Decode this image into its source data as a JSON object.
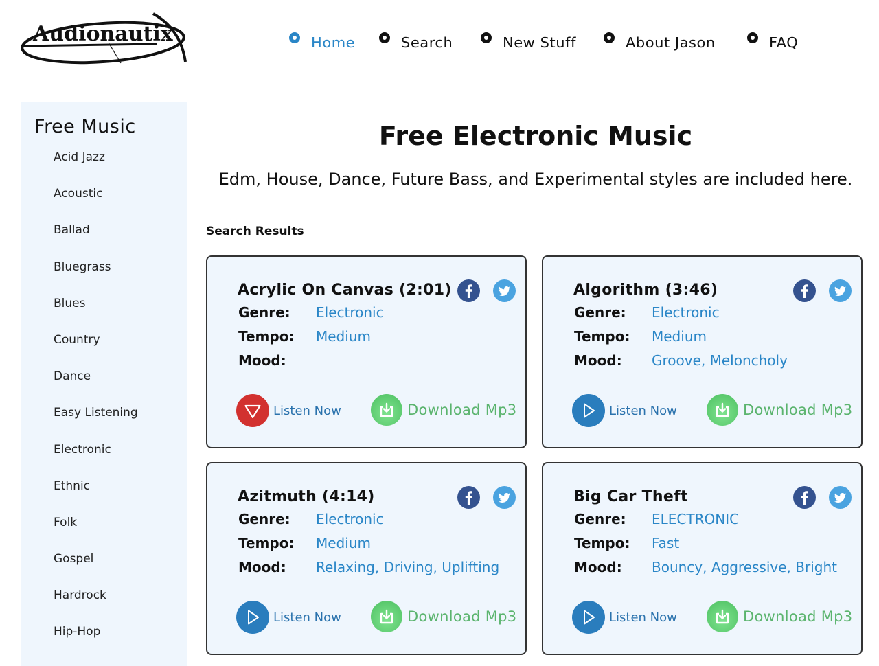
{
  "header": {
    "logo_text": "Audionautix",
    "nav": [
      {
        "label": "Home",
        "active": true
      },
      {
        "label": "Search",
        "active": false
      },
      {
        "label": "New Stuff",
        "active": false
      },
      {
        "label": "About Jason",
        "active": false
      },
      {
        "label": "FAQ",
        "active": false
      }
    ]
  },
  "sidebar": {
    "title": "Free Music",
    "items": [
      "Acid Jazz",
      "Acoustic",
      "Ballad",
      "Bluegrass",
      "Blues",
      "Country",
      "Dance",
      "Easy Listening",
      "Electronic",
      "Ethnic",
      "Folk",
      "Gospel",
      "Hardrock",
      "Hip-Hop"
    ]
  },
  "main": {
    "title": "Free Electronic Music",
    "subtitle": "Edm, House, Dance, Future Bass, and Experimental styles are included here.",
    "results_heading": "Search Results",
    "labels": {
      "genre": "Genre:",
      "tempo": "Tempo:",
      "mood": "Mood:"
    },
    "listen_label": "Listen Now",
    "download_label": "Download Mp3",
    "results": [
      {
        "title": "Acrylic On Canvas (2:01)",
        "genre": "Electronic",
        "tempo": "Medium",
        "mood": "",
        "playing": true
      },
      {
        "title": "Algorithm (3:46)",
        "genre": "Electronic",
        "tempo": "Medium",
        "mood": "Groove, Meloncholy",
        "playing": false
      },
      {
        "title": "Azitmuth (4:14)",
        "genre": "Electronic",
        "tempo": "Medium",
        "mood": "Relaxing, Driving, Uplifting",
        "playing": false
      },
      {
        "title": "Big Car Theft",
        "genre": "ELECTRONIC",
        "tempo": "Fast",
        "mood": "Bouncy, Aggressive, Bright",
        "playing": false
      }
    ]
  },
  "colors": {
    "accent": "#2a86c7",
    "sidebar_bg": "#eff6fd",
    "playing_red": "#d2312f",
    "play_blue": "#2a7dbd",
    "download_green": "#5bb46e",
    "facebook": "#34528f",
    "twitter": "#4aa3e0"
  }
}
